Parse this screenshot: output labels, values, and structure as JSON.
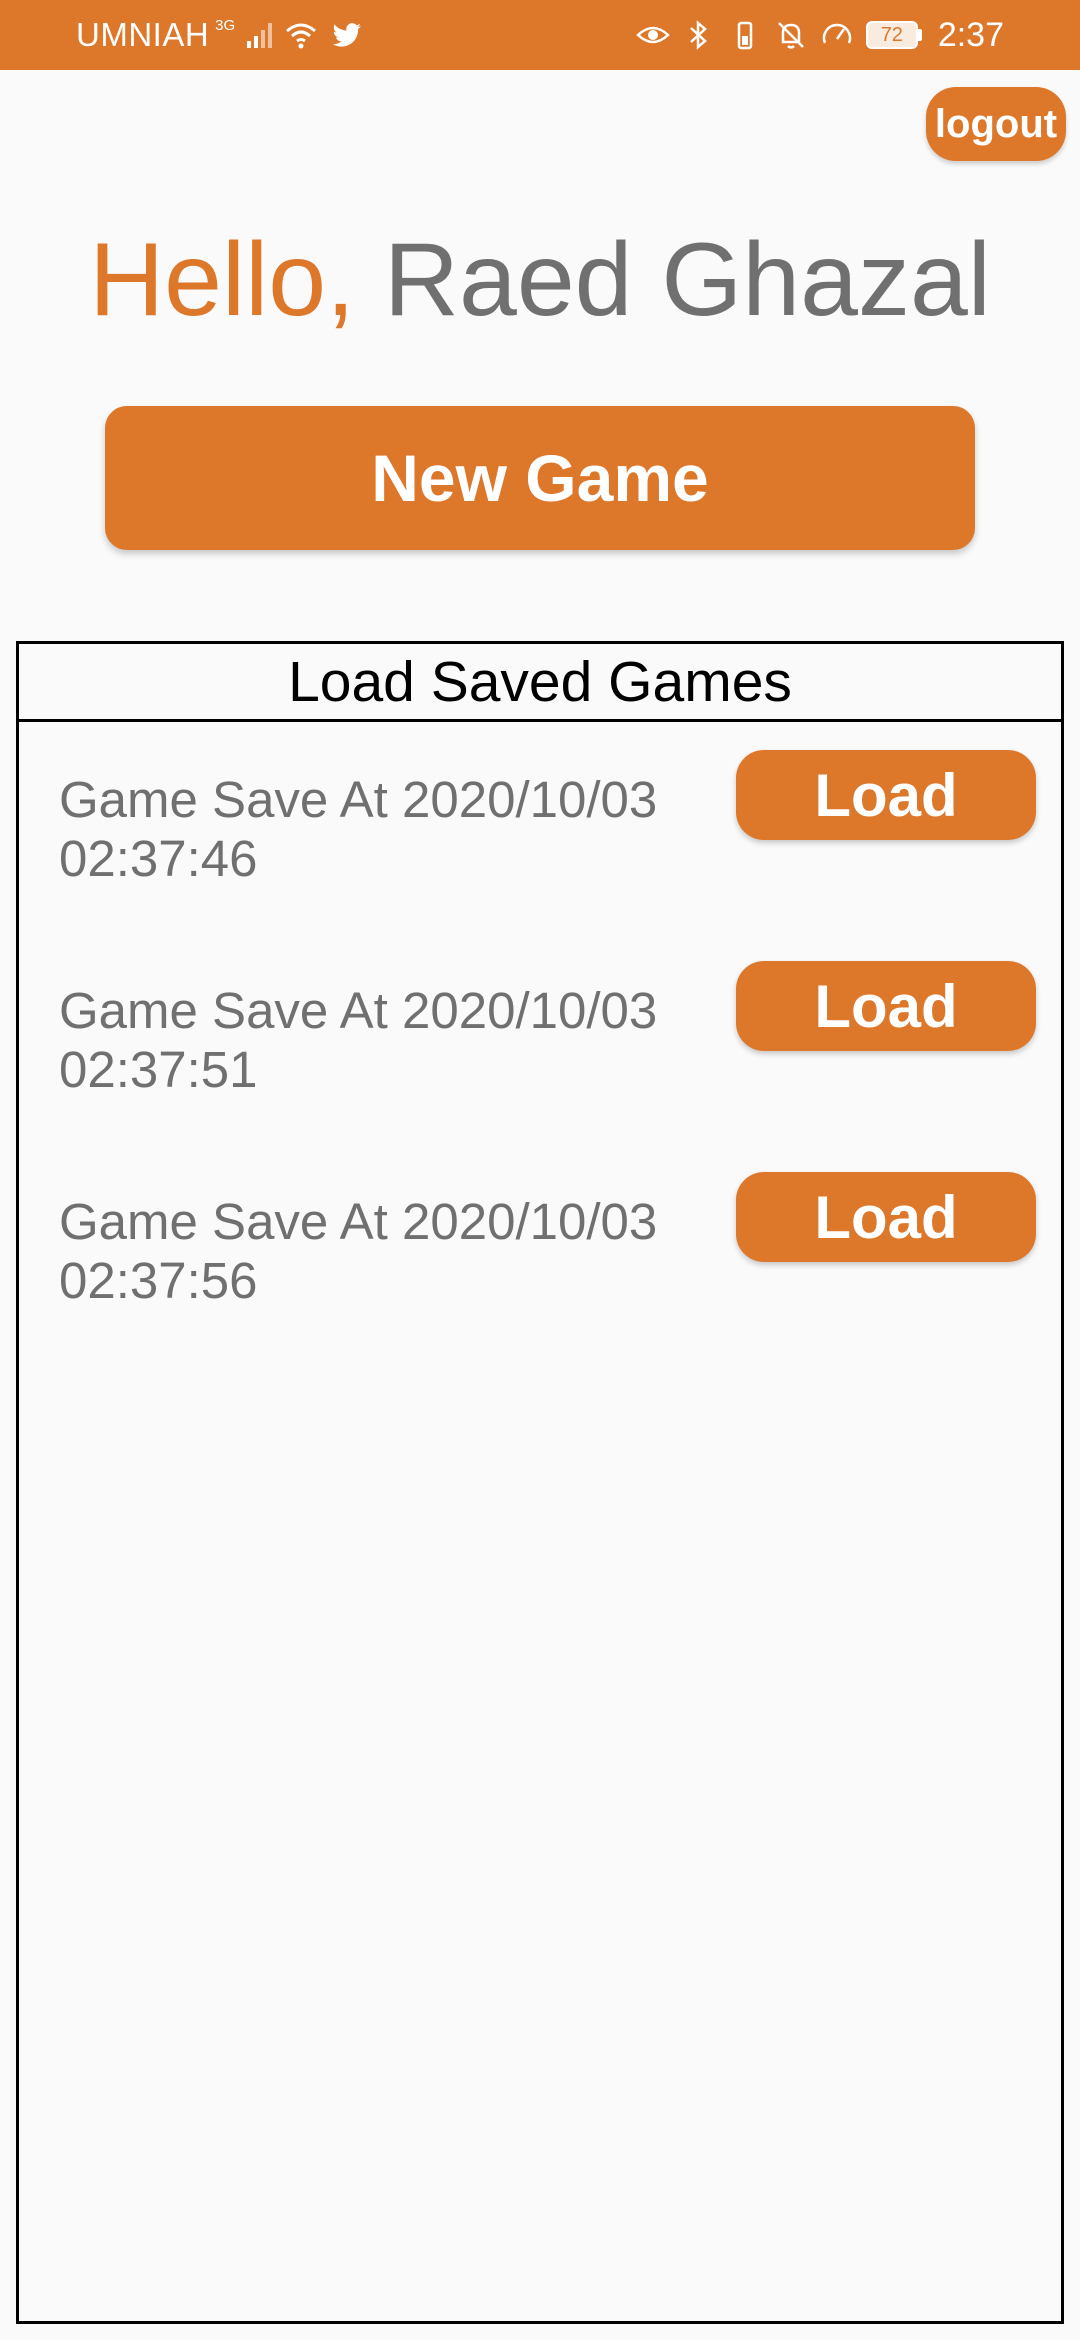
{
  "status_bar": {
    "carrier": "UMNIAH",
    "network_type": "3G",
    "battery_level": "72",
    "time": "2:37",
    "icons": [
      "signal-icon",
      "wifi-icon",
      "twitter-icon",
      "eye-icon",
      "bluetooth-icon",
      "vibrate-battery-icon",
      "bell-off-icon",
      "speed-icon",
      "battery-icon"
    ],
    "background_color": "#dd772a"
  },
  "header": {
    "logout_label": "logout"
  },
  "greeting": {
    "hello": "Hello,",
    "name": "Raed Ghazal"
  },
  "new_game_label": "New Game",
  "saved_games": {
    "title": "Load Saved Games",
    "load_label": "Load",
    "items": [
      {
        "date": "Game Save At 2020/10/03",
        "time": "02:37:46"
      },
      {
        "date": "Game Save At 2020/10/03",
        "time": "02:37:51"
      },
      {
        "date": "Game Save At 2020/10/03",
        "time": "02:37:56"
      }
    ]
  },
  "colors": {
    "accent": "#dd772a",
    "muted_text": "#707070",
    "background": "#fafafa"
  }
}
